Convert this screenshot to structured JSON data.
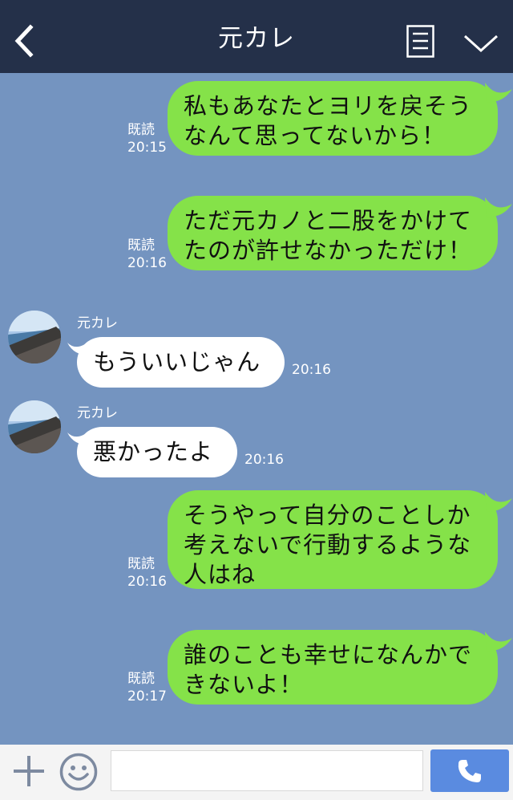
{
  "header": {
    "title": "元カレ"
  },
  "messages": [
    {
      "side": "me",
      "lines": [
        "私もあなたとヨリを戻そう",
        "なんて思ってないから！"
      ],
      "read": "既読",
      "time": "20:15"
    },
    {
      "side": "me",
      "lines": [
        "ただ元カノと二股をかけて",
        "たのが許せなかっただけ！"
      ],
      "read": "既読",
      "time": "20:16"
    },
    {
      "side": "them",
      "sender": "元カレ",
      "lines": [
        "もういいじゃん"
      ],
      "time": "20:16"
    },
    {
      "side": "them",
      "sender": "元カレ",
      "lines": [
        "悪かったよ"
      ],
      "time": "20:16"
    },
    {
      "side": "me",
      "lines": [
        "そうやって自分のことしか",
        "考えないで行動するような",
        "人はね"
      ],
      "read": "既読",
      "time": "20:16"
    },
    {
      "side": "me",
      "lines": [
        "誰のことも幸せになんかで",
        "きないよ！"
      ],
      "read": "既読",
      "time": "20:17"
    }
  ],
  "input": {
    "value": ""
  },
  "colors": {
    "header": "#243049",
    "background": "#7494c0",
    "my_bubble": "#85e249",
    "their_bubble": "#ffffff",
    "send_button": "#5a8be0"
  },
  "icons": {
    "back": "chevron-left-icon",
    "menu": "menu-list-icon",
    "collapse": "chevron-down-icon",
    "attach": "plus-icon",
    "emoji": "smiley-icon",
    "send": "phone-icon"
  }
}
